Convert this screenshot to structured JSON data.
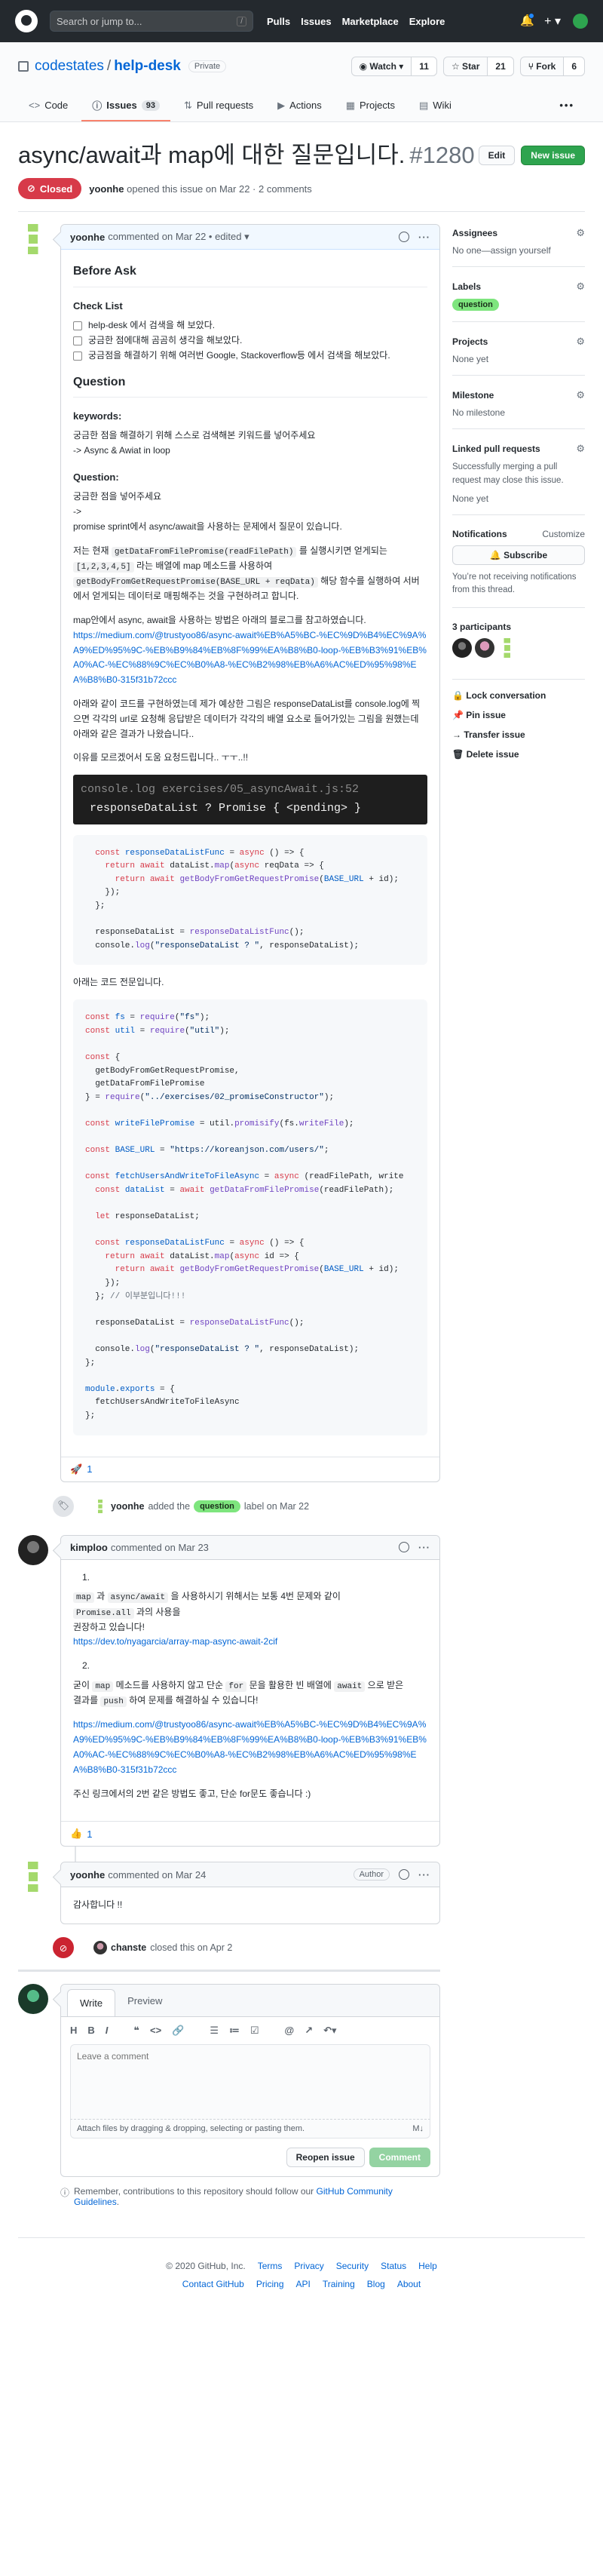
{
  "header": {
    "search_placeholder": "Search or jump to...",
    "slash_key": "/",
    "nav": [
      "Pulls",
      "Issues",
      "Marketplace",
      "Explore"
    ],
    "plus": "+ ▾"
  },
  "repo": {
    "owner": "codestates",
    "separator": "/",
    "name": "help-desk",
    "visibility": "Private",
    "watch_label": "◉ Watch ▾",
    "watch_count": "11",
    "star_label": "☆ Star",
    "star_count": "21",
    "fork_label": "⑂ Fork",
    "fork_count": "6",
    "tabs": [
      {
        "icon": "<>",
        "label": "Code"
      },
      {
        "icon": "ⓘ",
        "label": "Issues",
        "count": "93"
      },
      {
        "icon": "⇅",
        "label": "Pull requests"
      },
      {
        "icon": "▶",
        "label": "Actions"
      },
      {
        "icon": "▦",
        "label": "Projects"
      },
      {
        "icon": "▤",
        "label": "Wiki"
      }
    ],
    "more": "•••"
  },
  "issue": {
    "title": "async/await과 map에 대한 질문입니다.",
    "number": "#1280",
    "edit_label": "Edit",
    "new_issue_label": "New issue",
    "state": "Closed",
    "author": "yoonhe",
    "meta_text": "opened this issue on Mar 22 · 2 comments"
  },
  "comment1": {
    "author": "yoonhe",
    "meta": "commented on Mar 22 • edited ▾",
    "before_ask": "Before Ask",
    "checklist_title": "Check List",
    "tasks": [
      "help-desk 에서 검색을 해 보았다.",
      "궁금한 점에대해 곰곰히 생각을 해보았다.",
      "궁금점을 해결하기 위해 여러번 Google, Stackoverflow등 에서 검색을 해보았다."
    ],
    "question_heading": "Question",
    "keywords_label": "keywords:",
    "keywords_line1": "궁금한 점을 해결하기 위해 스스로 검색해본 키워드를 넣어주세요",
    "keywords_line2": "-> Async & Awiat in loop",
    "question_label": "Question:",
    "question_line1": "궁금한 점을 넣어주세요",
    "question_line2": "->",
    "question_line3": "promise sprint에서 async/await을 사용하는 문제에서 질문이 있습니다.",
    "p2_a": "저는 현재",
    "p2_code1": "getDataFromFilePromise(readFilePath)",
    "p2_b": "를 실행시키면 얻게되는",
    "p2_code2": "[1,2,3,4,5]",
    "p2_c": "라는 배열에 map 메소드를 사용하여",
    "p2_code3": "getBodyFromGetRequestPromise(BASE_URL + reqData)",
    "p2_d": "해당 함수를 실행하여 서버에서 얻게되는 데이터로 매핑해주는 것을 구현하려고 합니다.",
    "p3": "map안에서 async, await을 사용하는 방법은 아래의 블로그를 참고하였습니다.",
    "link1": "https://medium.com/@trustyoo86/async-await%EB%A5%BC-%EC%9D%B4%EC%9A%A9%ED%95%9C-%EB%B9%84%EB%8F%99%EA%B8%B0-loop-%EB%B3%91%EB%A0%AC-%EC%88%9C%EC%B0%A8-%EC%B2%98%EB%A6%AC%ED%95%98%EA%B8%B0-315f31b72ccc",
    "p4": "아래와 같이 코드를 구현하였는데 제가 예상한 그림은 responseDataList를 console.log에 찍으면 각각의 url로 요청해 응답받은 데이터가 각각의 배열 요소로 들어가있는 그림을 원했는데 아래와 같은 결과가 나왔습니다..",
    "p5": "이유를 모르겠어서 도움 요청드립니다.. ㅜㅜ..!!",
    "terminal_cmd": "console.log exercises/05_asyncAwait.js:52",
    "terminal_out": "responseDataList ?  Promise { <pending> }",
    "p6": "아래는 코드 전문입니다.",
    "reaction_emoji": "🚀",
    "reaction_count": "1"
  },
  "label_event": {
    "actor": "yoonhe",
    "text_before": "added the",
    "label": "question",
    "text_after": "label on Mar 22"
  },
  "comment2": {
    "author": "kimploo",
    "meta": "commented on Mar 23",
    "item1": "1.",
    "l1_code1": "map",
    "l1_a": "과",
    "l1_code2": "async/await",
    "l1_b": "을 사용하시기 위해서는 보통 4번 문제와 같이",
    "l1_code3": "Promise.all",
    "l1_c": "과의 사용을",
    "l1_d": "권장하고 있습니다!",
    "link1": "https://dev.to/nyagarcia/array-map-async-await-2cif",
    "item2": "2.",
    "l2_a": "굳이",
    "l2_code1": "map",
    "l2_b": "메소드를 사용하지 않고 단순",
    "l2_code2": "for",
    "l2_c": "문을 활용한 빈 배열에",
    "l2_code3": "await",
    "l2_d": "으로 받은",
    "l2_e": "결과를",
    "l2_code4": "push",
    "l2_f": "하여 문제를 해결하실 수 있습니다!",
    "link2": "https://medium.com/@trustyoo86/async-await%EB%A5%BC-%EC%9D%B4%EC%9A%A9%ED%95%9C-%EB%B9%84%EB%8F%99%EA%B8%B0-loop-%EB%B3%91%EB%A0%AC-%EC%88%9C%EC%B0%A8-%EC%B2%98%EB%A6%AC%ED%95%98%EA%B8%B0-315f31b72ccc",
    "p_last": "주신 링크에서의 2번 같은 방법도 좋고, 단순 for문도 좋습니다 :)",
    "reaction_emoji": "👍",
    "reaction_count": "1"
  },
  "comment3": {
    "author": "yoonhe",
    "meta": "commented on Mar 24",
    "badge": "Author",
    "body": "감사합니다 !!"
  },
  "closed_event": {
    "actor": "chanste",
    "text": "closed this on Apr 2"
  },
  "new_comment": {
    "tab_write": "Write",
    "tab_preview": "Preview",
    "toolbar": [
      "H",
      "B",
      "I",
      "❝",
      "<>",
      "🔗",
      "☰",
      "≔",
      "☑",
      "@",
      "↗",
      "↶▾"
    ],
    "placeholder": "Leave a comment",
    "attach_text": "Attach files by dragging & dropping, selecting or pasting them.",
    "md_badge": "M↓",
    "reopen_label": "Reopen issue",
    "comment_label": "Comment"
  },
  "tip": {
    "text": "Remember, contributions to this repository should follow our",
    "link": "GitHub Community Guidelines",
    "end": "."
  },
  "sidebar": {
    "assignees_title": "Assignees",
    "assignees_value": "No one—assign yourself",
    "labels_title": "Labels",
    "labels_value": "question",
    "projects_title": "Projects",
    "projects_value": "None yet",
    "milestone_title": "Milestone",
    "milestone_value": "No milestone",
    "linked_title": "Linked pull requests",
    "linked_desc": "Successfully merging a pull request may close this issue.",
    "linked_value": "None yet",
    "notifications_title": "Notifications",
    "customize": "Customize",
    "subscribe_label": "🔔 Subscribe",
    "notifications_desc": "You’re not receiving notifications from this thread.",
    "participants_title": "3 participants",
    "lock": "🔒 Lock conversation",
    "pin": "📌 Pin issue",
    "transfer": "→ Transfer issue",
    "delete": "🗑 Delete issue"
  },
  "footer": {
    "copyright": "© 2020 GitHub, Inc.",
    "row1": [
      "Terms",
      "Privacy",
      "Security",
      "Status",
      "Help"
    ],
    "row2": [
      "Contact GitHub",
      "Pricing",
      "API",
      "Training",
      "Blog",
      "About"
    ]
  }
}
